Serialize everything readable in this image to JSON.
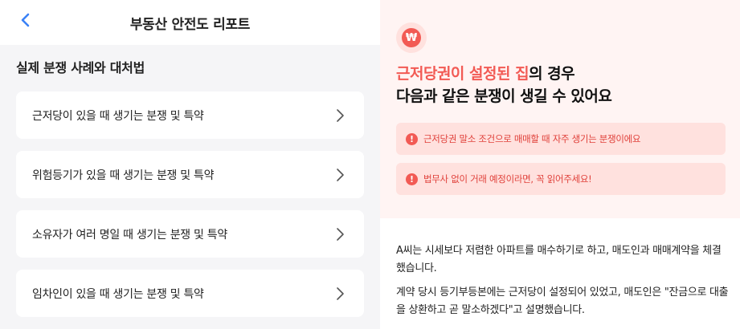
{
  "header": {
    "title": "부동산 안전도 리포트"
  },
  "section": {
    "title": "실제 분쟁 사례와 대처법"
  },
  "cases": [
    {
      "label": "근저당이 있을 때 생기는 분쟁 및 특약"
    },
    {
      "label": "위험등기가 있을 때 생기는 분쟁 및 특약"
    },
    {
      "label": "소유자가 여러 명일 때 생기는 분쟁 및 특약"
    },
    {
      "label": "임차인이 있을 때 생기는 분쟁 및 특약"
    }
  ],
  "detail": {
    "badge_symbol": "₩",
    "headline_highlight": "근저당권이 설정된 집",
    "headline_rest1": "의 경우",
    "headline_line2": "다음과 같은 분쟁이 생길 수 있어요",
    "alerts": [
      {
        "text": "근저당권 말소 조건으로 매매할 때 자주 생기는 분쟁이에요"
      },
      {
        "text": "법무사 없이 거래 예정이라면, 꼭 읽어주세요!"
      }
    ],
    "paragraph1": "A씨는 시세보다 저렴한 아파트를 매수하기로 하고, 매도인과 매매계약을 체결했습니다.",
    "paragraph2": "계약 당시 등기부등본에는 근저당이 설정되어 있었고, 매도인은 \"잔금으로 대출을 상환하고 곧 말소하겠다\"고 설명했습니다."
  },
  "colors": {
    "accent": "#f25a54",
    "accent_bg": "#fff4f3",
    "alert_bg": "#ffe1de",
    "back_arrow": "#3b82f6"
  }
}
